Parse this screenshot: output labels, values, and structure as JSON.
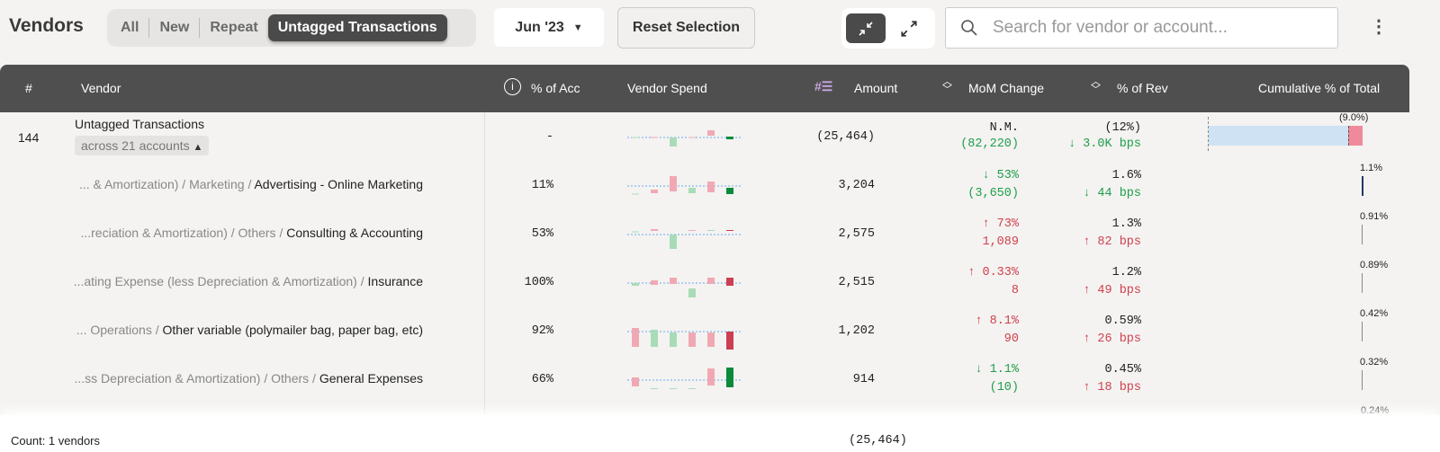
{
  "header": {
    "title": "Vendors",
    "tabs": [
      {
        "label": "All",
        "active": false
      },
      {
        "label": "New",
        "active": false
      },
      {
        "label": "Repeat",
        "active": false
      },
      {
        "label": "Untagged Transactions",
        "active": true
      }
    ],
    "month": "Jun '23",
    "reset_label": "Reset Selection",
    "search_placeholder": "Search for vendor or account...",
    "icons": {
      "collapse": "collapse-arrows-icon",
      "expand": "expand-arrows-icon",
      "search": "search-icon",
      "more": "kebab-menu-icon"
    }
  },
  "columns": {
    "num": "#",
    "vendor": "Vendor",
    "pct_acc": "% of Acc",
    "spend": "Vendor Spend",
    "amount": "Amount",
    "mom": "MoM Change",
    "pct_rev": "% of Rev",
    "cumulative": "Cumulative % of Total"
  },
  "colors": {
    "header_bg": "#4f4f4f",
    "positive": "#1e9e4a",
    "negative": "#d0404f",
    "cum_bar": "#cfe2f3",
    "cum_accent": "#f08a9a",
    "sort_icon": "#c9a6e0"
  },
  "summary": {
    "num": "144",
    "vendor": "Untagged Transactions",
    "accounts_label": "across 21 accounts",
    "pct_acc": "-",
    "amount": "(25,464)",
    "mom_pct": "N.M.",
    "mom_abs": "(82,220)",
    "pct_rev": "(12%)",
    "rev_bps": "↓ 3.0K bps",
    "cum_label": "(9.0%)",
    "spark": [
      [
        0,
        0.5,
        "g"
      ],
      [
        0,
        0.5,
        "r"
      ],
      [
        -10,
        0,
        "g"
      ],
      [
        0,
        0.5,
        "r"
      ],
      [
        2,
        8,
        "r"
      ],
      [
        -2,
        1,
        "G"
      ]
    ]
  },
  "rows": [
    {
      "path": "... & Amortization) / Marketing / ",
      "name": "Advertising - Online Marketing",
      "pct_acc": "11%",
      "amount": "3,204",
      "mom_pct": "↓ 53%",
      "mom_abs": "(3,650)",
      "mom_color": "g",
      "pct_rev": "1.6%",
      "rev_bps": "↓ 44 bps",
      "rev_color": "g",
      "cum": "1.1%",
      "spark": [
        [
          -9,
          -8.5,
          "g"
        ],
        [
          -8,
          -4,
          "r"
        ],
        [
          -6,
          11,
          "r"
        ],
        [
          -8,
          -2,
          "g"
        ],
        [
          -7,
          5,
          "r"
        ],
        [
          -9,
          -2,
          "G"
        ]
      ]
    },
    {
      "path": "...reciation & Amortization) / Others / ",
      "name": "Consulting & Accounting",
      "pct_acc": "53%",
      "amount": "2,575",
      "mom_pct": "↑ 73%",
      "mom_abs": "1,089",
      "mom_color": "r",
      "pct_rev": "1.3%",
      "rev_bps": "↑ 82 bps",
      "rev_color": "r",
      "cum": "0.91%",
      "spark": [
        [
          3,
          3.5,
          "g"
        ],
        [
          4,
          6,
          "r"
        ],
        [
          -16,
          0,
          "g"
        ],
        [
          4,
          5,
          "r"
        ],
        [
          4,
          5,
          "g"
        ],
        [
          4,
          5,
          "R"
        ]
      ]
    },
    {
      "path": "...ating Expense (less Depreciation & Amortization) / ",
      "name": "Insurance",
      "pct_acc": "100%",
      "amount": "2,515",
      "mom_pct": "↑ 0.33%",
      "mom_abs": "8",
      "mom_color": "r",
      "pct_rev": "1.2%",
      "rev_bps": "↑ 49 bps",
      "rev_color": "r",
      "cum": "0.89%",
      "spark": [
        [
          -3,
          0,
          "g"
        ],
        [
          -2,
          3,
          "r"
        ],
        [
          -1,
          6,
          "r"
        ],
        [
          -16,
          -6,
          "g"
        ],
        [
          -1,
          6,
          "r"
        ],
        [
          -3,
          6,
          "R"
        ]
      ]
    },
    {
      "path": "... Operations / ",
      "name": "Other variable (polymailer bag, paper bag, etc)",
      "pct_acc": "92%",
      "amount": "1,202",
      "mom_pct": "↑ 8.1%",
      "mom_abs": "90",
      "mom_color": "r",
      "pct_rev": "0.59%",
      "rev_bps": "↑ 26 bps",
      "rev_color": "r",
      "cum": "0.42%",
      "spark": [
        [
          -17,
          4,
          "r"
        ],
        [
          -17,
          2,
          "g"
        ],
        [
          -17,
          -1,
          "g"
        ],
        [
          -17,
          -1,
          "r"
        ],
        [
          -17,
          -1,
          "r"
        ],
        [
          -20,
          0,
          "R"
        ]
      ]
    },
    {
      "path": "...ss Depreciation & Amortization) / Others / ",
      "name": "General Expenses",
      "pct_acc": "66%",
      "amount": "914",
      "mom_pct": "↓ 1.1%",
      "mom_abs": "(10)",
      "mom_color": "g",
      "pct_rev": "0.45%",
      "rev_bps": "↑ 18 bps",
      "rev_color": "r",
      "cum": "0.32%",
      "spark": [
        [
          -7,
          3,
          "r"
        ],
        [
          -9,
          -9,
          "g"
        ],
        [
          -9,
          -9,
          "g"
        ],
        [
          -9,
          -9,
          "g"
        ],
        [
          -6,
          13,
          "r"
        ],
        [
          -8,
          14,
          "G"
        ]
      ]
    }
  ],
  "partial_cum": "0.24%",
  "footer": {
    "count": "Count: 1 vendors",
    "total": "(25,464)"
  }
}
